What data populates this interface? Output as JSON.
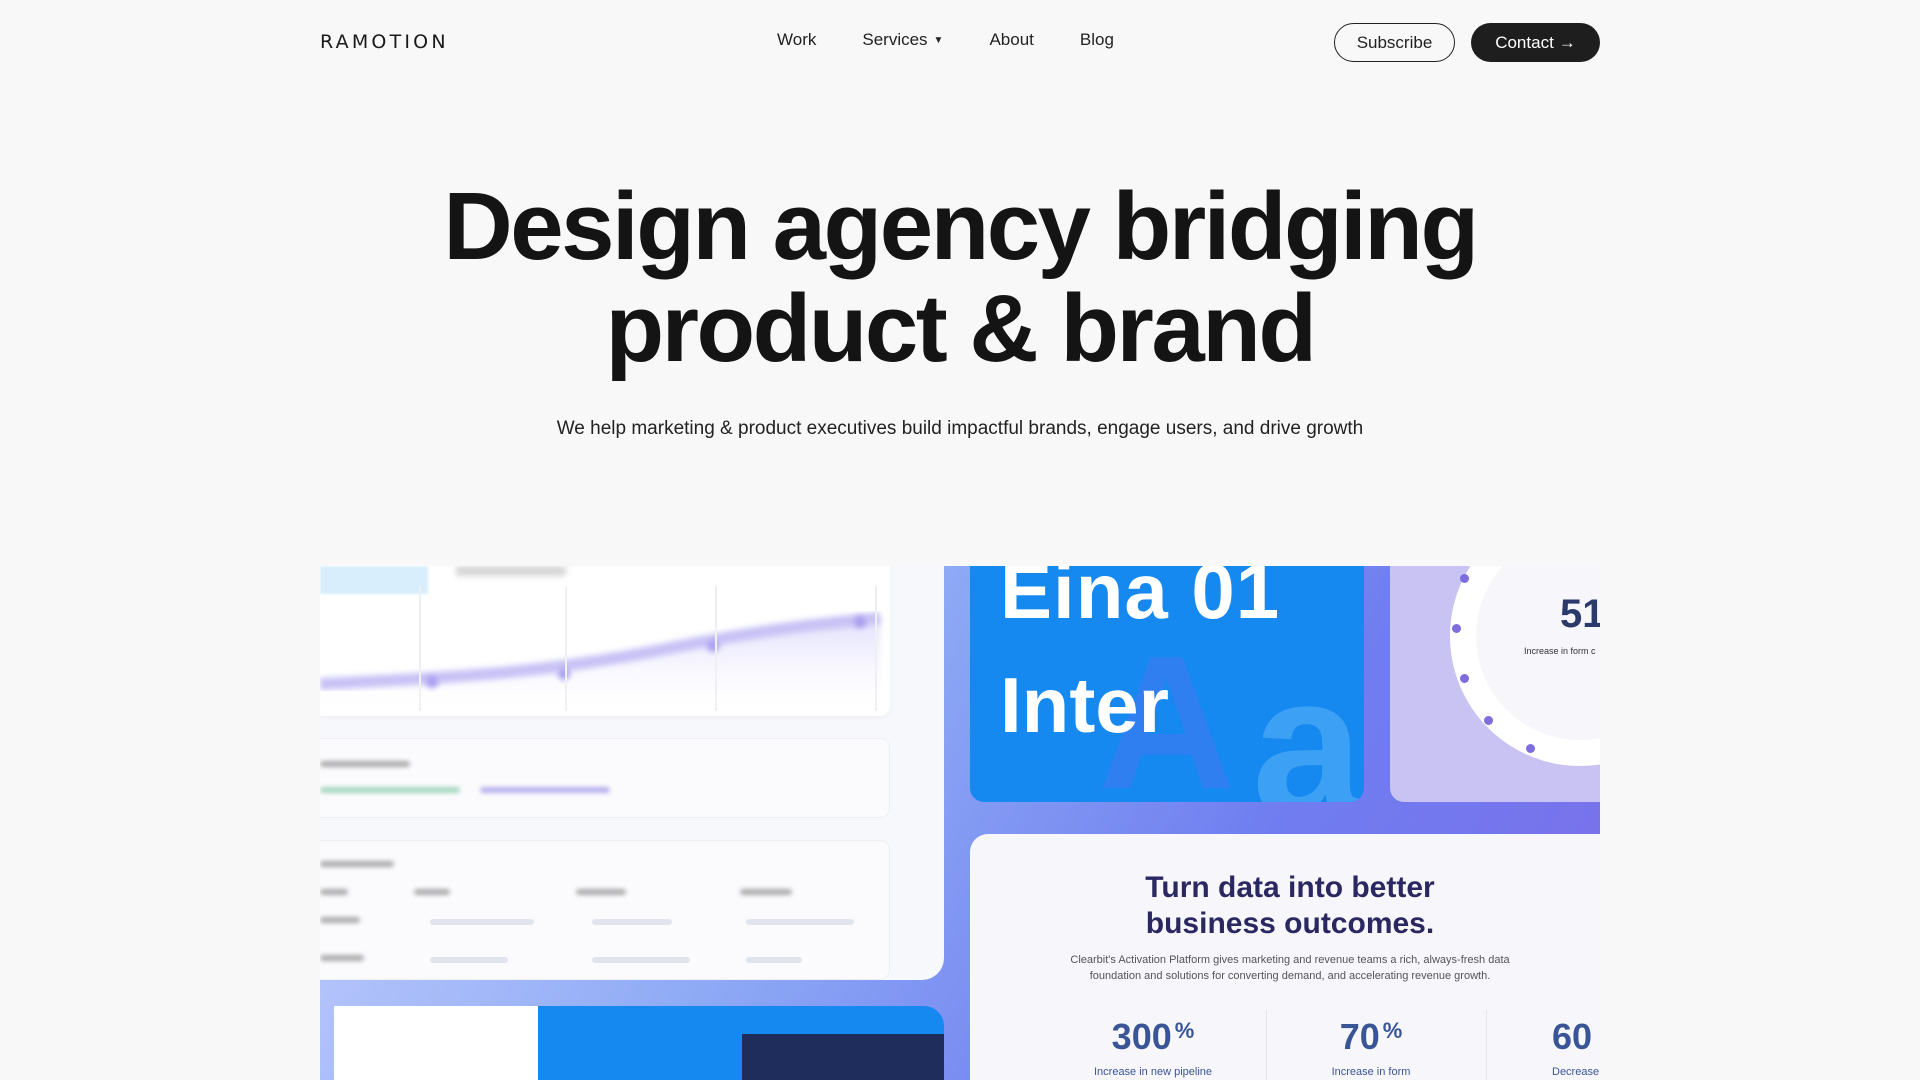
{
  "header": {
    "logo": "RAMOTION",
    "nav": [
      {
        "label": "Work"
      },
      {
        "label": "Services",
        "has_dropdown": true
      },
      {
        "label": "About"
      },
      {
        "label": "Blog"
      }
    ],
    "caret": "▼",
    "subscribe_label": "Subscribe",
    "contact_label": "Contact",
    "contact_arrow": "→"
  },
  "hero": {
    "title_line1": "Design agency bridging",
    "title_line2": "product & brand",
    "subtitle": "We help marketing & product executives build impactful brands, engage users, and drive growth"
  },
  "showcase": {
    "type_specimen": {
      "line1": "Eina 01",
      "line2": "Inter",
      "glyph_big": "A",
      "glyph_small": "a"
    },
    "ring_stat": {
      "value": "51",
      "caption": "Increase in form c"
    },
    "card": {
      "title_line1": "Turn data into better",
      "title_line2": "business outcomes.",
      "desc_line1": "Clearbit's Activation Platform gives marketing and revenue teams a rich, always-fresh data",
      "desc_line2": "foundation and solutions for converting demand, and accelerating revenue growth.",
      "stats": [
        {
          "value": "300",
          "suffix": "%",
          "label": "Increase in new pipeline"
        },
        {
          "value": "70",
          "suffix": "%",
          "label": "Increase in form"
        },
        {
          "value": "60",
          "suffix": "",
          "label": "Decrease"
        }
      ]
    }
  },
  "colors": {
    "background": "#f8f8f9",
    "dark_button": "#1e1e1e",
    "brand_blue": "#1589ef",
    "purple_ring": "#c8c3f3",
    "card_title": "#2b2760",
    "stat_blue": "#3a5596"
  }
}
